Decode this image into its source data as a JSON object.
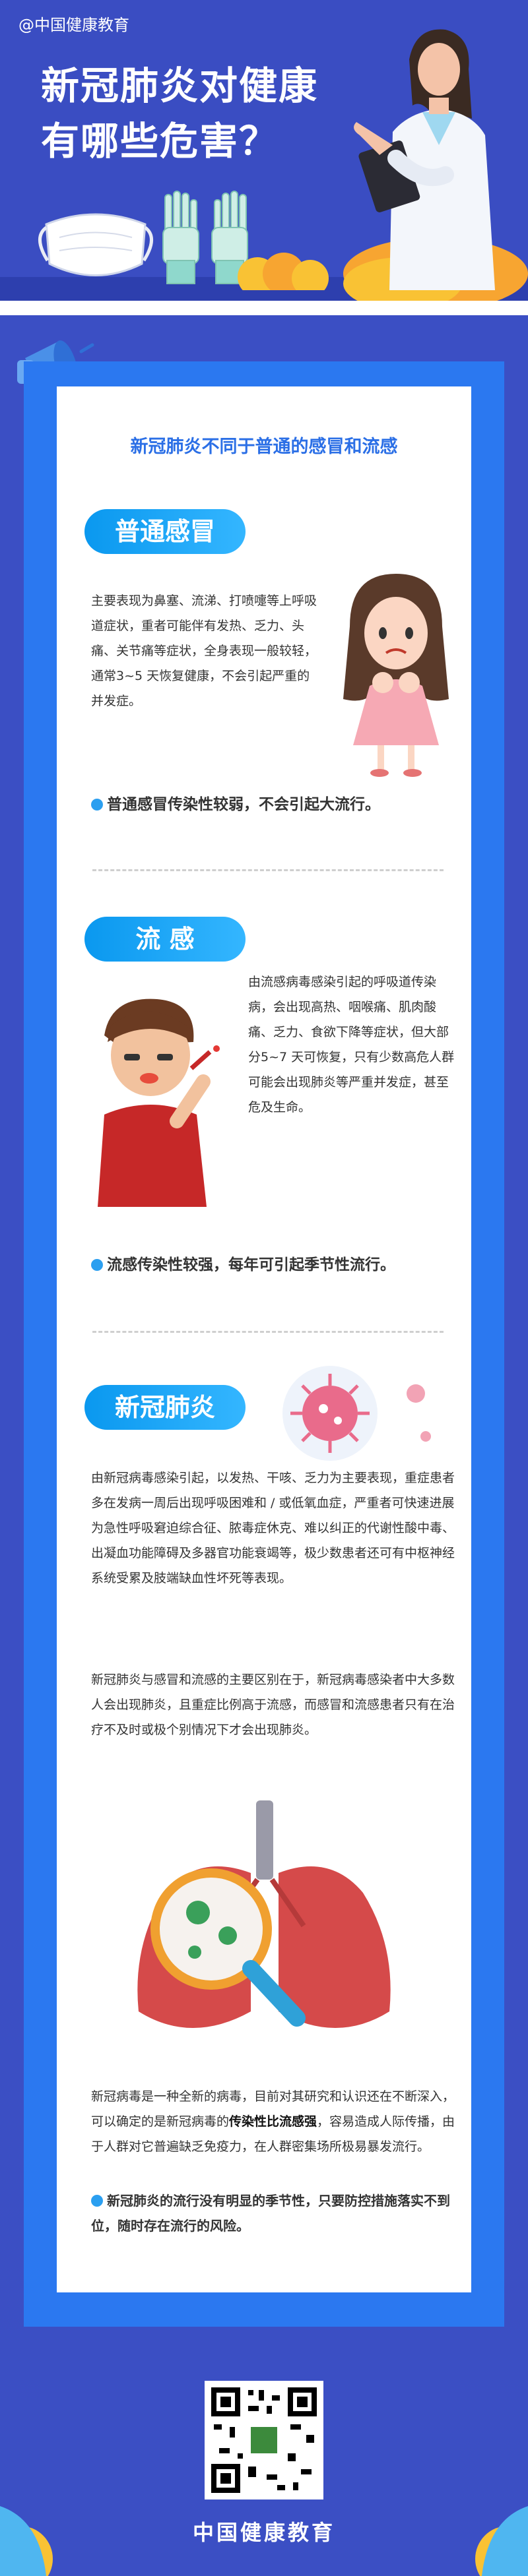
{
  "header": {
    "watermark": "@中国健康教育",
    "title_line1": "新冠肺炎对健康",
    "title_line2": "有哪些危害？"
  },
  "subtitle": "新冠肺炎不同于普通的感冒和流感",
  "cold": {
    "label": "普通感冒",
    "text": "主要表现为鼻塞、流涕、打喷嚏等上呼吸道症状，重者可能伴有发热、乏力、头痛、关节痛等症状，全身表现一般较轻，通常3~5 天恢复健康，不会引起严重的并发症。",
    "bullet": "普通感冒传染性较弱，不会引起大流行。"
  },
  "flu": {
    "label": "流 感",
    "text": "由流感病毒感染引起的呼吸道传染病，会出现高热、咽喉痛、肌肉酸痛、乏力、食欲下降等症状，但大部分5~7 天可恢复，只有少数高危人群可能会出现肺炎等严重并发症，甚至危及生命。",
    "bullet": "流感传染性较强，每年可引起季节性流行。"
  },
  "covid": {
    "label": "新冠肺炎",
    "text1": "由新冠病毒感染引起，以发热、干咳、乏力为主要表现，重症患者多在发病一周后出现呼吸困难和 / 或低氧血症，严重者可快速进展为急性呼吸窘迫综合征、脓毒症休克、难以纠正的代谢性酸中毒、出凝血功能障碍及多器官功能衰竭等，极少数患者还可有中枢神经系统受累及肢端缺血性坏死等表现。",
    "text2": "新冠肺炎与感冒和流感的主要区别在于，新冠病毒感染者中大多数人会出现肺炎，且重症比例高于流感，而感冒和流感患者只有在治疗不及时或极个别情况下才会出现肺炎。",
    "text3_a": "新冠病毒是一种全新的病毒，目前对其研究和认识还在不断深入，可以确定的是新冠病毒的",
    "text3_b": "传染性比流感强",
    "text3_c": "，容易造成人际传播，由于人群对它普遍缺乏免疫力，在人群密集场所极易暴发流行。",
    "bullet": "新冠肺炎的流行没有明显的季节性，只要防控措施落实不到位，随时存在流行的风险。"
  },
  "footer": {
    "name": "中国健康教育"
  },
  "colors": {
    "bg": "#3b4fc4",
    "panel_border": "#2b78f0",
    "accent": "#2b9ff0",
    "subtitle": "#2b6fe6"
  }
}
